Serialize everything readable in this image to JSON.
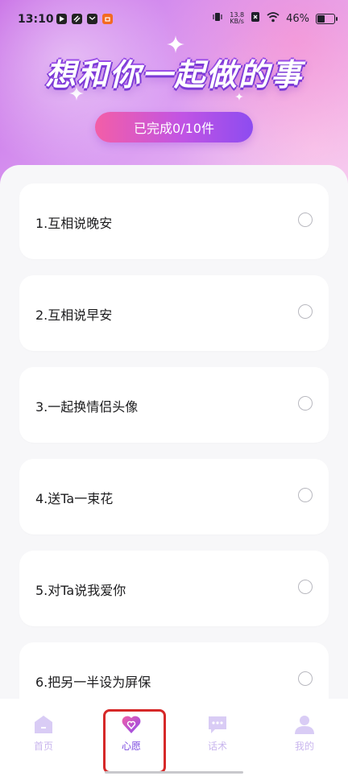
{
  "status_bar": {
    "time": "13:10",
    "net_speed_value": "13.8",
    "net_speed_unit": "KB/s",
    "battery": "46%",
    "battery_level": 0.46,
    "app_icons": [
      "play-icon",
      "link-icon",
      "mail-icon",
      "shop-icon"
    ]
  },
  "header": {
    "title": "想和你一起做的事",
    "progress_label": "已完成0/10件",
    "progress_completed": 0,
    "progress_total": 10
  },
  "wishes": [
    {
      "label": "1.互相说晚安",
      "checked": false
    },
    {
      "label": "2.互相说早安",
      "checked": false
    },
    {
      "label": "3.一起换情侣头像",
      "checked": false
    },
    {
      "label": "4.送Ta一束花",
      "checked": false
    },
    {
      "label": "5.对Ta说我爱你",
      "checked": false
    },
    {
      "label": "6.把另一半设为屏保",
      "checked": false
    }
  ],
  "tabbar": {
    "items": [
      {
        "label": "首页",
        "icon": "home-icon",
        "active": false
      },
      {
        "label": "心愿",
        "icon": "heart-icon",
        "active": true
      },
      {
        "label": "话术",
        "icon": "chat-icon",
        "active": false
      },
      {
        "label": "我的",
        "icon": "user-icon",
        "active": false
      }
    ]
  },
  "colors": {
    "accent": "#7c4be0",
    "badge_start": "#f35ea7",
    "badge_end": "#8d4cf0",
    "inactive_tab": "#c9b6ee",
    "highlight": "#d62828"
  }
}
